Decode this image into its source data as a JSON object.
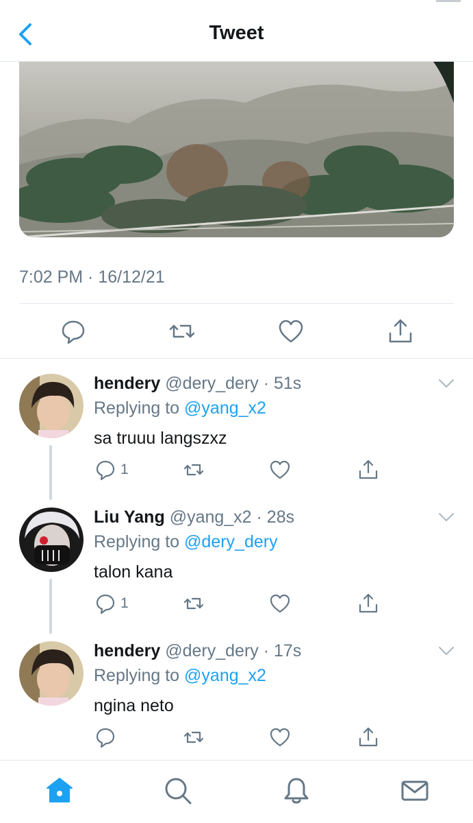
{
  "header": {
    "title": "Tweet",
    "back_icon": "chevron-left-icon"
  },
  "tweet": {
    "timestamp": "7:02 PM · 16/12/21",
    "actions": [
      "reply-icon",
      "retweet-icon",
      "like-icon",
      "share-icon"
    ]
  },
  "replies": [
    {
      "name": "hendery",
      "handle": "@dery_dery · 51s",
      "replying_prefix": "Replying to",
      "replying_to": "@yang_x2",
      "text": "sa truuu langszxz",
      "reply_count": "1"
    },
    {
      "name": "Liu Yang",
      "handle": "@yang_x2 · 28s",
      "replying_prefix": "Replying to",
      "replying_to": "@dery_dery",
      "text": "talon kana",
      "reply_count": "1"
    },
    {
      "name": "hendery",
      "handle": "@dery_dery · 17s",
      "replying_prefix": "Replying to",
      "replying_to": "@yang_x2",
      "text": "ngina neto",
      "reply_count": ""
    }
  ],
  "tabbar": {
    "items": [
      "home-icon",
      "search-icon",
      "notifications-icon",
      "messages-icon"
    ],
    "active": "home-icon"
  },
  "colors": {
    "accent": "#1da1f2",
    "secondary_text": "#657786",
    "primary_text": "#14171a",
    "divider": "#e1e8ed",
    "icon": "#657786"
  }
}
